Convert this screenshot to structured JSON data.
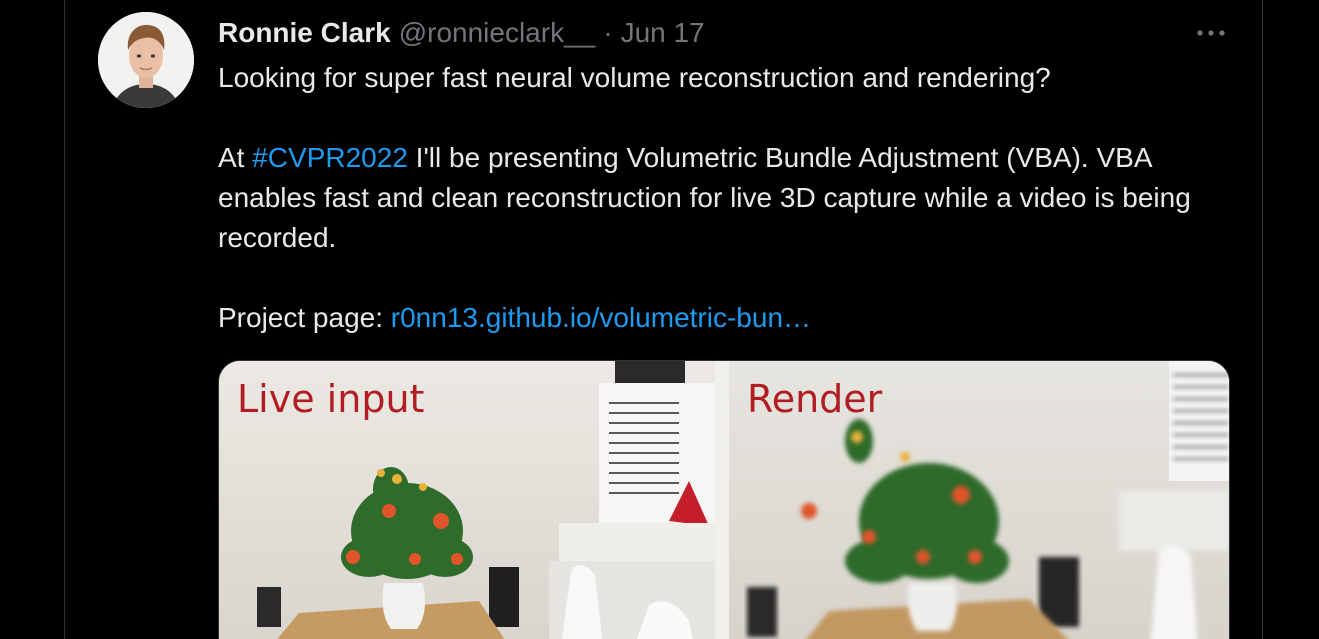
{
  "tweet": {
    "author": {
      "display_name": "Ronnie Clark",
      "handle": "@ronnieclark__",
      "separator": "·",
      "date": "Jun 17"
    },
    "more_icon": "more-horizontal-icon",
    "text": {
      "line1": "Looking for super fast neural volume reconstruction and rendering?",
      "para2_prefix": "At ",
      "hashtag": "#CVPR2022",
      "para2_rest": " I'll be presenting Volumetric Bundle Adjustment (VBA). VBA enables fast and clean reconstruction for live 3D capture while a video is being recorded.",
      "project_label": "Project page: ",
      "project_link": "r0nn13.github.io/volumetric-bun…"
    },
    "media": {
      "left_label": "Live input",
      "right_label": "Render"
    }
  },
  "colors": {
    "background": "#000000",
    "text": "#e7e9ea",
    "muted": "#71767b",
    "link": "#1d9bf0",
    "label_red": "#b11d22"
  }
}
